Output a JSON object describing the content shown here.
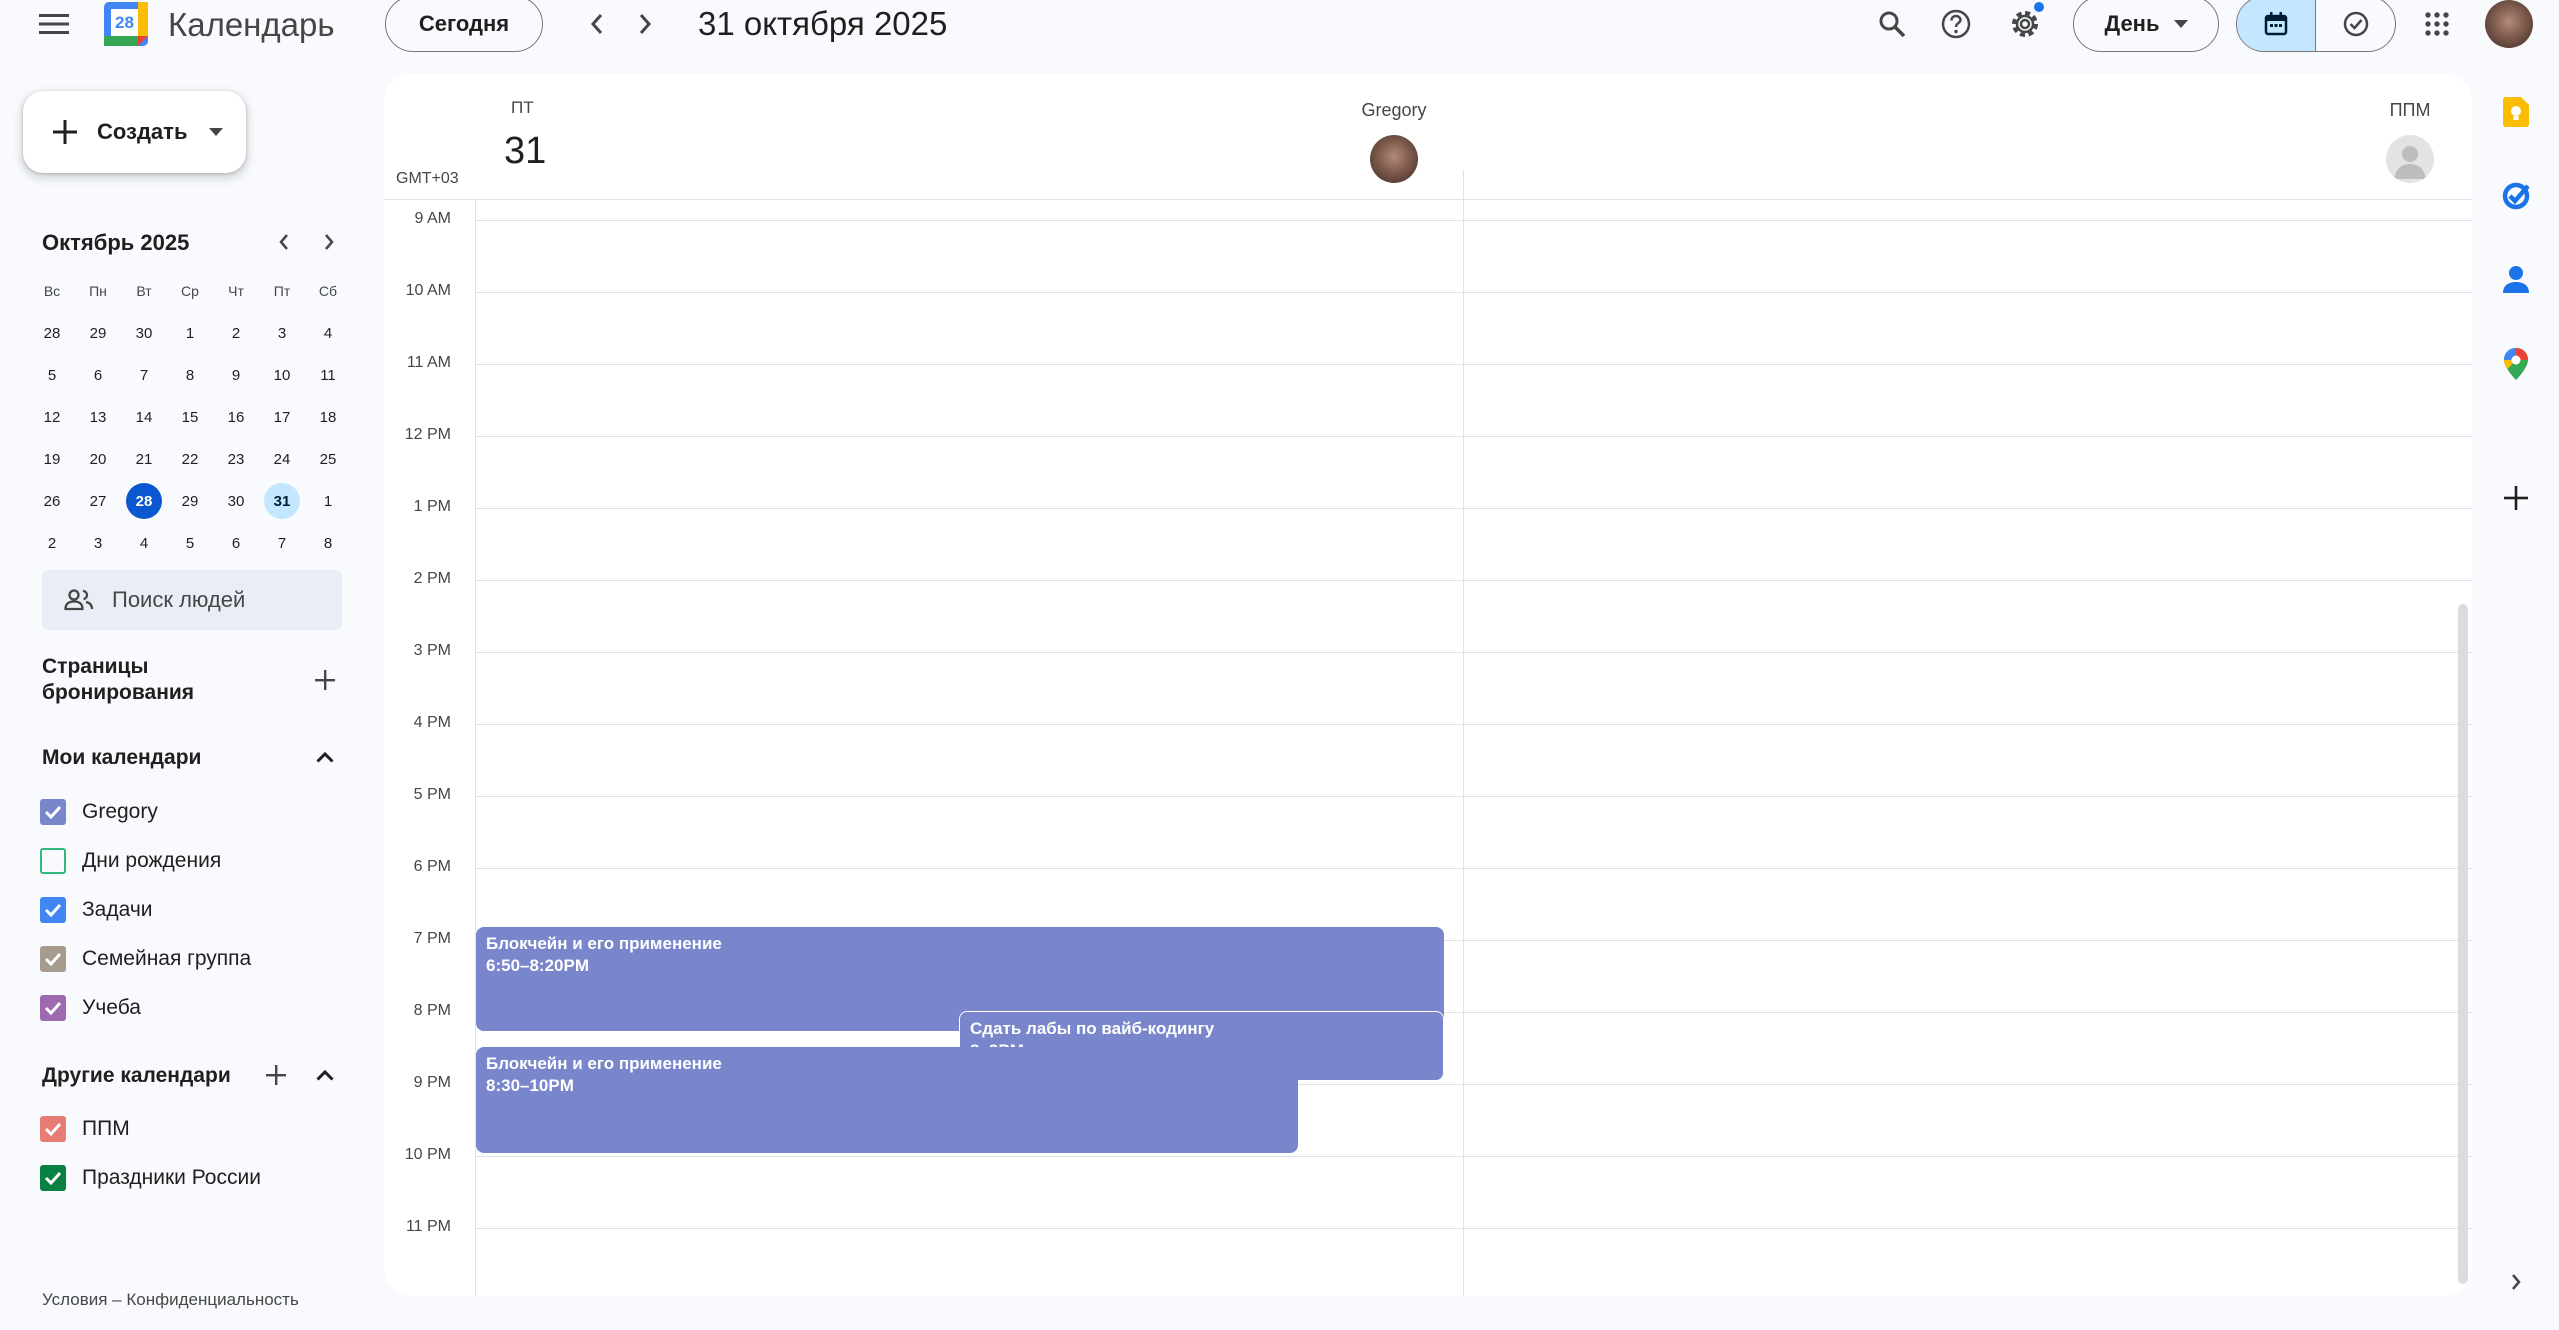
{
  "header": {
    "app_name": "Календарь",
    "logo_day": "28",
    "today_button": "Сегодня",
    "date_title": "31 октября 2025",
    "view_select": "День"
  },
  "create": {
    "label": "Создать"
  },
  "mini_calendar": {
    "title": "Октябрь 2025",
    "weekdays": [
      "Вс",
      "Пн",
      "Вт",
      "Ср",
      "Чт",
      "Пт",
      "Сб"
    ],
    "weeks": [
      [
        "28",
        "29",
        "30",
        "1",
        "2",
        "3",
        "4"
      ],
      [
        "5",
        "6",
        "7",
        "8",
        "9",
        "10",
        "11"
      ],
      [
        "12",
        "13",
        "14",
        "15",
        "16",
        "17",
        "18"
      ],
      [
        "19",
        "20",
        "21",
        "22",
        "23",
        "24",
        "25"
      ],
      [
        "26",
        "27",
        "28",
        "29",
        "30",
        "31",
        "1"
      ],
      [
        "2",
        "3",
        "4",
        "5",
        "6",
        "7",
        "8"
      ]
    ],
    "today": "28",
    "selected": "31"
  },
  "people_search": {
    "placeholder": "Поиск людей"
  },
  "booking_pages": {
    "title": "Страницы бронирования"
  },
  "my_calendars": {
    "title": "Мои календари",
    "items": [
      {
        "label": "Gregory",
        "color": "#7986cb",
        "checked": true
      },
      {
        "label": "Дни рождения",
        "color": "#33b679",
        "checked": false
      },
      {
        "label": "Задачи",
        "color": "#4285f4",
        "checked": true
      },
      {
        "label": "Семейная группа",
        "color": "#a79b8e",
        "checked": true
      },
      {
        "label": "Учеба",
        "color": "#9e69af",
        "checked": true
      }
    ]
  },
  "other_calendars": {
    "title": "Другие календари",
    "items": [
      {
        "label": "ППМ",
        "color": "#e67c73",
        "checked": true
      },
      {
        "label": "Праздники России",
        "color": "#0b8043",
        "checked": true
      }
    ]
  },
  "footer": {
    "text": "Условия – Конфиденциальность"
  },
  "day_view": {
    "day_of_week": "ПТ",
    "day_number": "31",
    "timezone": "GMT+03",
    "columns": [
      {
        "name": "Gregory"
      },
      {
        "name": "ППМ"
      }
    ],
    "hours": [
      "9 AM",
      "10 AM",
      "11 AM",
      "12 PM",
      "1 PM",
      "2 PM",
      "3 PM",
      "4 PM",
      "5 PM",
      "6 PM",
      "7 PM",
      "8 PM",
      "9 PM",
      "10 PM",
      "11 PM"
    ]
  },
  "events": [
    {
      "title": "Блокчейн и его применение",
      "time": "6:50–8:20PM",
      "color": "#7986cb"
    },
    {
      "title": "Сдать лабы по вайб-кодингу",
      "time": "8–9PM",
      "color": "#7986cb"
    },
    {
      "title": "Блокчейн и его применение",
      "time": "8:30–10PM",
      "color": "#7986cb"
    }
  ],
  "colors": {
    "accent": "#0b57d0",
    "event": "#7986cb",
    "selected_bg": "#c2e7ff"
  }
}
